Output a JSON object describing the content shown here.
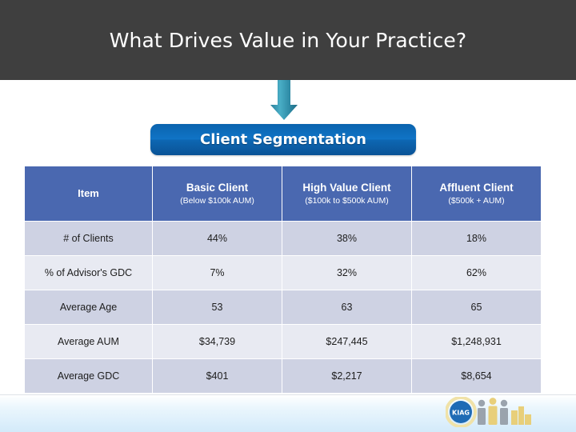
{
  "slide": {
    "title": "What Drives Value in Your Practice?",
    "callout_label": "Client Segmentation",
    "arrow_icon": "down-arrow-icon",
    "colors": {
      "title_band": "#3f3f3f",
      "title_text": "#ffffff",
      "arrow": "#3a9ab5",
      "pill": "#1074c6",
      "table_header": "#4a68b0",
      "row_odd": "#ced2e3",
      "row_even": "#e8eaf2",
      "bottom_band": "#d3eafa"
    }
  },
  "table": {
    "columns": [
      {
        "main": "Item",
        "sub": ""
      },
      {
        "main": "Basic Client",
        "sub": "(Below $100k AUM)"
      },
      {
        "main": "High Value Client",
        "sub": "($100k to $500k AUM)"
      },
      {
        "main": "Affluent Client",
        "sub": "($500k + AUM)"
      }
    ],
    "rows": [
      {
        "label": "# of Clients",
        "values": [
          "44%",
          "38%",
          "18%"
        ]
      },
      {
        "label": "% of Advisor's GDC",
        "values": [
          "7%",
          "32%",
          "62%"
        ]
      },
      {
        "label": "Average Age",
        "values": [
          "53",
          "63",
          "65"
        ]
      },
      {
        "label": "Average AUM",
        "values": [
          "$34,739",
          "$247,445",
          "$1,248,931"
        ]
      },
      {
        "label": "Average GDC",
        "values": [
          "$401",
          "$2,217",
          "$8,654"
        ]
      }
    ]
  },
  "logo": {
    "name": "kiag-logo",
    "text": "KIAG",
    "circle_color": "#1f6bb5",
    "ring_color": "#f0e2a8",
    "figure_color": "#9aa3ad",
    "accent_color": "#e8cf7a"
  }
}
